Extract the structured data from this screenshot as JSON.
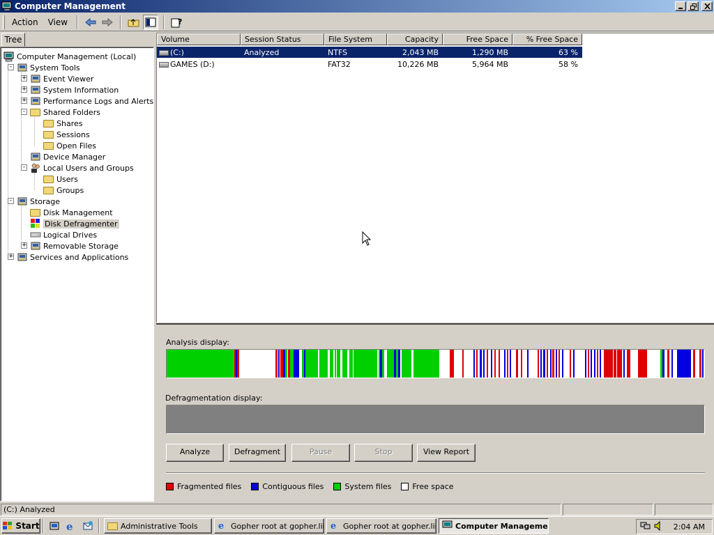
{
  "window": {
    "title": "Computer Management",
    "icon": "computer-management-icon",
    "controls": [
      "minimize-icon",
      "restore-icon",
      "close-icon"
    ]
  },
  "menu": {
    "action": "Action",
    "view": "View",
    "toolbar_icons": [
      "back-icon",
      "forward-icon",
      "up-folder-icon",
      "show-hide-tree-icon",
      "help-icon"
    ]
  },
  "tree": {
    "tab_label": "Tree",
    "items": [
      {
        "label": "Computer Management (Local)",
        "icon": "computer-icon",
        "level": 0
      },
      {
        "label": "System Tools",
        "icon": "tools-icon",
        "level": 1,
        "expander": "-"
      },
      {
        "label": "Event Viewer",
        "icon": "event-viewer-icon",
        "level": 2,
        "expander": "+"
      },
      {
        "label": "System Information",
        "icon": "system-info-icon",
        "level": 2,
        "expander": "+"
      },
      {
        "label": "Performance Logs and Alerts",
        "icon": "performance-icon",
        "level": 2,
        "expander": "+"
      },
      {
        "label": "Shared Folders",
        "icon": "shared-folder-icon",
        "level": 2,
        "expander": "-"
      },
      {
        "label": "Shares",
        "icon": "folder-icon",
        "level": 3
      },
      {
        "label": "Sessions",
        "icon": "folder-icon",
        "level": 3
      },
      {
        "label": "Open Files",
        "icon": "folder-icon",
        "level": 3
      },
      {
        "label": "Device Manager",
        "icon": "device-manager-icon",
        "level": 2
      },
      {
        "label": "Local Users and Groups",
        "icon": "users-icon",
        "level": 2,
        "expander": "-"
      },
      {
        "label": "Users",
        "icon": "folder-icon",
        "level": 3
      },
      {
        "label": "Groups",
        "icon": "folder-icon",
        "level": 3
      },
      {
        "label": "Storage",
        "icon": "storage-icon",
        "level": 1,
        "expander": "-"
      },
      {
        "label": "Disk Management",
        "icon": "folder-icon",
        "level": 2
      },
      {
        "label": "Disk Defragmenter",
        "icon": "defrag-icon",
        "level": 2,
        "selected": true
      },
      {
        "label": "Logical Drives",
        "icon": "drive-icon",
        "level": 2
      },
      {
        "label": "Removable Storage",
        "icon": "removable-storage-icon",
        "level": 2,
        "expander": "+"
      },
      {
        "label": "Services and Applications",
        "icon": "services-icon",
        "level": 1,
        "expander": "+"
      }
    ]
  },
  "volumes": {
    "columns": [
      "Volume",
      "Session Status",
      "File System",
      "Capacity",
      "Free Space",
      "% Free Space"
    ],
    "rows": [
      {
        "volume": "(C:)",
        "status": "Analyzed",
        "fs": "NTFS",
        "capacity": "2,043 MB",
        "free": "1,290 MB",
        "pct": "63 %",
        "selected": true
      },
      {
        "volume": "GAMES (D:)",
        "status": "",
        "fs": "FAT32",
        "capacity": "10,226 MB",
        "free": "5,964 MB",
        "pct": "58 %",
        "selected": false
      }
    ]
  },
  "defrag": {
    "analysis_label": "Analysis display:",
    "defrag_label": "Defragmentation display:",
    "buttons": {
      "analyze": "Analyze",
      "defragment": "Defragment",
      "pause": "Pause",
      "stop": "Stop",
      "view_report": "View Report"
    },
    "legend": {
      "fragmented": "Fragmented files",
      "contiguous": "Contiguous files",
      "system": "System files",
      "free": "Free space"
    },
    "colors": {
      "fragmented": "#e00000",
      "contiguous": "#0000e0",
      "system": "#00d000",
      "free": "#ffffff",
      "defrag_empty": "#808080"
    }
  },
  "status": {
    "text": "(C:) Analyzed"
  },
  "taskbar": {
    "start": "Start",
    "quicklaunch_icons": [
      "show-desktop-icon",
      "internet-explorer-icon",
      "outlook-express-icon"
    ],
    "tasks": [
      {
        "label": "Administrative Tools",
        "icon": "folder-icon",
        "active": false
      },
      {
        "label": "Gopher root at gopher.lin...",
        "icon": "internet-explorer-icon",
        "active": false
      },
      {
        "label": "Gopher root at gopher.lin...",
        "icon": "internet-explorer-icon",
        "active": false
      },
      {
        "label": "Computer Management",
        "icon": "computer-management-icon",
        "active": true
      }
    ],
    "tray_icons": [
      "network-icon",
      "volume-icon"
    ],
    "clock": "2:04 AM"
  }
}
